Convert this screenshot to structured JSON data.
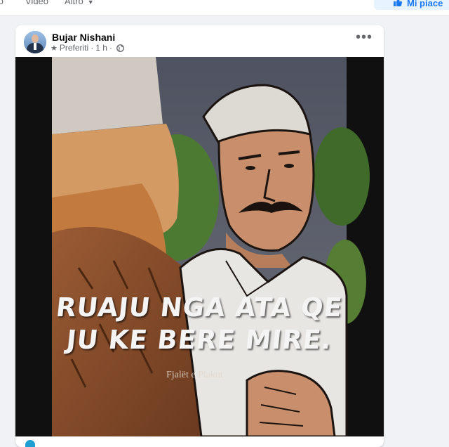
{
  "top_tabs": [
    "to",
    "Video",
    "Altro"
  ],
  "like_button": {
    "label": "Mi piace"
  },
  "post": {
    "author": "Bujar Nishani",
    "audience": "Preferiti",
    "time": "1 h",
    "more_label": "•••",
    "image": {
      "caption_line_1": "RUAJU NGA ATA QE",
      "caption_line_2": "JU KE BERE MIRE.",
      "signature": "Fjalët e Plakut"
    }
  },
  "colors": {
    "accent": "#1877f2",
    "page_bg": "#f0f2f5",
    "card_bg": "#ffffff",
    "secondary_text": "#65676b"
  },
  "icons": {
    "star": "star-icon",
    "globe": "globe-icon",
    "thumb": "thumbs-up-icon",
    "caret": "chevron-down-icon"
  }
}
